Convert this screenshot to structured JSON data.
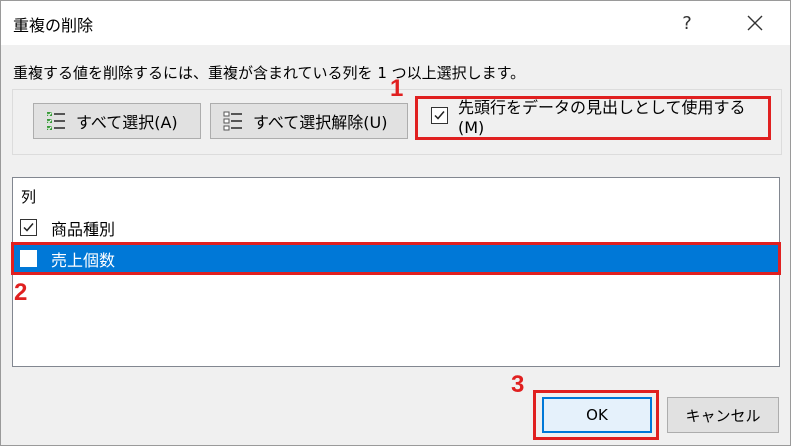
{
  "dialog": {
    "title": "重複の削除",
    "help": "?",
    "instruction": "重複する値を削除するには、重複が含まれている列を 1 つ以上選択します。"
  },
  "toolbar": {
    "select_all_label": "すべて選択(A)",
    "deselect_all_label": "すべて選択解除(U)",
    "header_checkbox_label": "先頭行をデータの見出しとして使用する(M)",
    "header_checkbox_checked": true
  },
  "columns": {
    "header": "列",
    "items": [
      {
        "label": "商品種別",
        "checked": true,
        "selected": false
      },
      {
        "label": "売上個数",
        "checked": false,
        "selected": true
      }
    ]
  },
  "footer": {
    "ok_label": "OK",
    "cancel_label": "キャンセル"
  },
  "annotations": {
    "n1": "1",
    "n2": "2",
    "n3": "3"
  },
  "colors": {
    "accent": "#0078d7",
    "annotation": "#e02020"
  }
}
